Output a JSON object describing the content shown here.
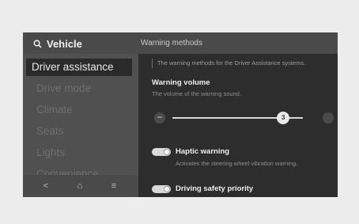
{
  "header": {
    "title": "Vehicle",
    "section": "Warning methods"
  },
  "sidebar": {
    "items": [
      {
        "label": "Driver assistance",
        "active": true
      },
      {
        "label": "Drive mode",
        "active": false
      },
      {
        "label": "Climate",
        "active": false
      },
      {
        "label": "Seats",
        "active": false
      },
      {
        "label": "Lights",
        "active": false
      },
      {
        "label": "Convenience",
        "active": false
      }
    ]
  },
  "bottom_nav": {
    "back_icon": "<",
    "home_icon": "⌂",
    "menu_icon": "≡"
  },
  "panel": {
    "description": "The warning methods for the Driver Assistance systems.",
    "warning_volume": {
      "title": "Warning volume",
      "description": "The volume of the warning sound.",
      "minus_label": "−",
      "value": "3",
      "level_fraction": 0.85
    },
    "haptic_warning": {
      "title": "Haptic warning",
      "description": "Activates the steering wheel vibration warning.",
      "enabled": true
    },
    "driving_safety_priority": {
      "title": "Driving safety priority",
      "enabled": true
    }
  },
  "colors": {
    "background": "#ececec",
    "screen": "#3a3a3a",
    "sidebar": "#505050",
    "panel": "#2d2d2d",
    "active_item": "#2a2a2a"
  }
}
